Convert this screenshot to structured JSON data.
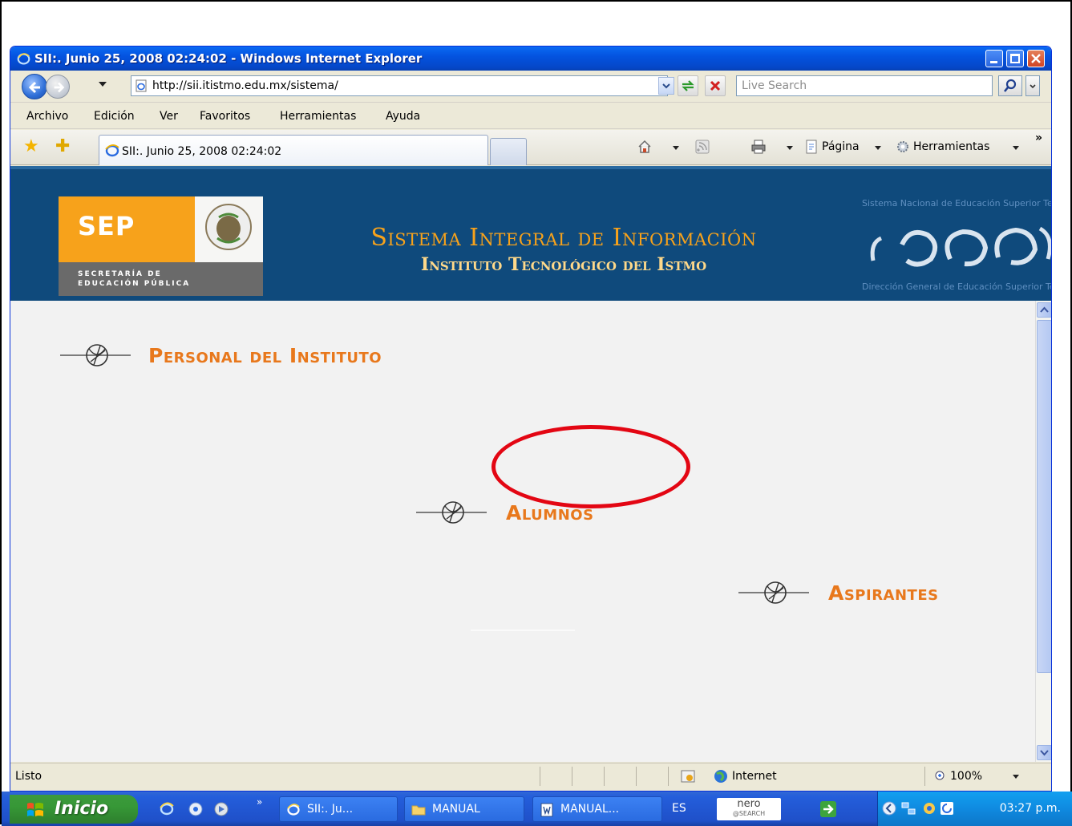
{
  "window": {
    "title": "SII:. Junio 25, 2008 02:24:02 - Windows Internet Explorer",
    "url": "http://sii.itistmo.edu.mx/sistema/",
    "search_placeholder": "Live Search"
  },
  "menu": [
    "Archivo",
    "Edición",
    "Ver",
    "Favoritos",
    "Herramientas",
    "Ayuda"
  ],
  "tab": {
    "label": "SII:. Junio 25, 2008 02:24:02"
  },
  "commandbar": {
    "page_label": "Página",
    "tools_label": "Herramientas"
  },
  "banner": {
    "sep_word": "SEP",
    "sep_line1": "SECRETARÍA DE",
    "sep_line2": "EDUCACIÓN PÚBLICA",
    "title": "Sistema Integral de Información",
    "subtitle": "Instituto Tecnológico del Istmo",
    "sns_top": "Sistema Nacional de Educación Superior Tecnológica",
    "sns_bottom": "Dirección General de Educación Superior Tecnológica"
  },
  "links": {
    "personal": "Personal del Instituto",
    "alumnos": "Alumnos",
    "aspirantes": "Aspirantes"
  },
  "status": {
    "text": "Listo",
    "zone": "Internet",
    "zoom": "100%"
  },
  "taskbar": {
    "start": "Inicio",
    "buttons": [
      "SII:. Ju...",
      "MANUAL",
      "MANUAL..."
    ],
    "lang": "ES",
    "nero_line1": "nero",
    "nero_line2": "@SEARCH",
    "clock": "03:27 p.m."
  },
  "colors": {
    "banner": "#0f4a7c",
    "accent_orange": "#e8781c",
    "highlight": "#e30613"
  }
}
